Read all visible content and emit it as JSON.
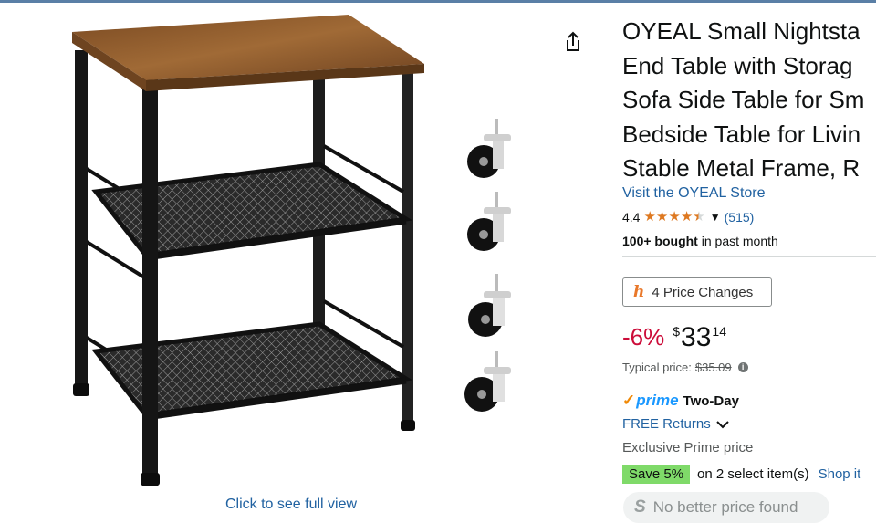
{
  "product": {
    "title_lines": [
      "OYEAL Small Nightsta",
      "End Table with Storag",
      "Sofa Side Table for Sm",
      "Bedside Table for Livin",
      "Stable Metal Frame, R"
    ],
    "store_link": "Visit the OYEAL Store",
    "rating": "4.4",
    "stars": 4.4,
    "review_count": "(515)",
    "bought_bold": "100+ bought",
    "bought_rest": " in past month"
  },
  "price_history": {
    "label": "4 Price Changes",
    "icon": "keepa-h-icon"
  },
  "price": {
    "discount": "-6%",
    "currency": "$",
    "whole": "33",
    "fraction": "14",
    "typical_label": "Typical price: ",
    "typical_value": "$35.09"
  },
  "delivery": {
    "prime_word": "prime",
    "prime_speed": "Two-Day",
    "free_returns": "FREE Returns",
    "exclusive": "Exclusive Prime price"
  },
  "promo": {
    "badge": "Save 5%",
    "text": "on 2 select item(s)",
    "link": "Shop it"
  },
  "better_price": {
    "label": "No better price found"
  },
  "image": {
    "full_view_link": "Click to see full view"
  },
  "colors": {
    "link": "#2162a1",
    "discount": "#cc0c39",
    "star": "#de7921",
    "prime": "#1a98ff",
    "save_badge": "#7fda69",
    "wood": "#8a5a2c",
    "metal": "#1a1a1a"
  }
}
